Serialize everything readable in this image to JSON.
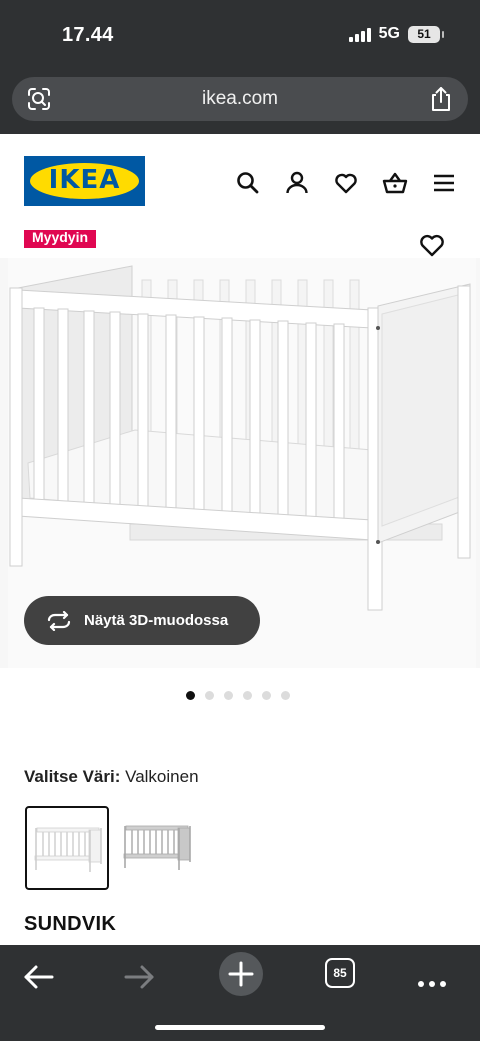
{
  "status_bar": {
    "time": "17.44",
    "network": "5G",
    "battery": "51"
  },
  "browser": {
    "url": "ikea.com"
  },
  "site": {
    "logo_text": "IKEA",
    "brand_colors": {
      "blue": "#0058a3",
      "yellow": "#ffdb00"
    },
    "header_icons": [
      "search-icon",
      "profile-icon",
      "heart-icon",
      "shopping-bag-icon",
      "menu-icon"
    ]
  },
  "product": {
    "badge": "Myydyin",
    "badge_color": "#e00751",
    "view_3d_label": "Näytä 3D-muodossa",
    "gallery": {
      "count": 6,
      "active_index": 0
    },
    "color_label": "Valitse Väri:",
    "color_value": "Valkoinen",
    "swatches": [
      {
        "name": "Valkoinen",
        "selected": true
      },
      {
        "name": "Harmaa",
        "selected": false
      }
    ],
    "name": "SUNDVIK"
  },
  "toolbar": {
    "tab_count": "85",
    "icons": [
      "back-icon",
      "forward-icon",
      "new-tab-icon",
      "tabs-icon",
      "more-icon"
    ]
  }
}
